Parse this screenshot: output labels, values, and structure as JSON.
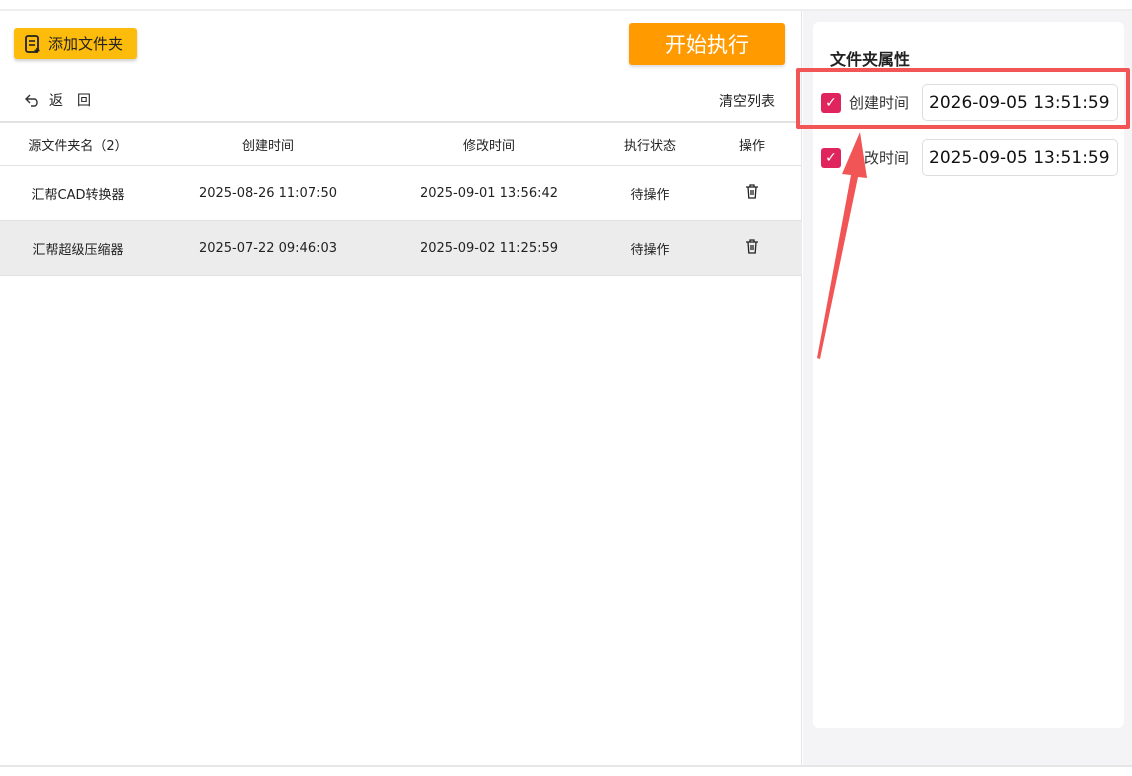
{
  "toolbar": {
    "add_folder": "添加文件夹",
    "start": "开始执行",
    "back": "返　回",
    "clear_list": "清空列表"
  },
  "table": {
    "headers": [
      "源文件夹名（2）",
      "创建时间",
      "修改时间",
      "执行状态",
      "操作"
    ],
    "rows": [
      {
        "name": "汇帮CAD转换器",
        "created": "2025-08-26 11:07:50",
        "modified": "2025-09-01 13:56:42",
        "status": "待操作",
        "action": "trash-icon"
      },
      {
        "name": "汇帮超级压缩器",
        "created": "2025-07-22 09:46:03",
        "modified": "2025-09-02 11:25:59",
        "status": "待操作",
        "action": "trash-icon"
      }
    ]
  },
  "props": {
    "title": "文件夹属性",
    "items": [
      {
        "label": "创建时间",
        "value": "2026-09-05 13:51:59",
        "checked": true
      },
      {
        "label": "修改时间",
        "value": "2025-09-05 13:51:59",
        "checked": true
      }
    ]
  },
  "colors": {
    "accent_yellow": "#fdbb0b",
    "accent_orange": "#ff9a00",
    "checkbox": "#e0245e",
    "annotation": "#f25555"
  }
}
